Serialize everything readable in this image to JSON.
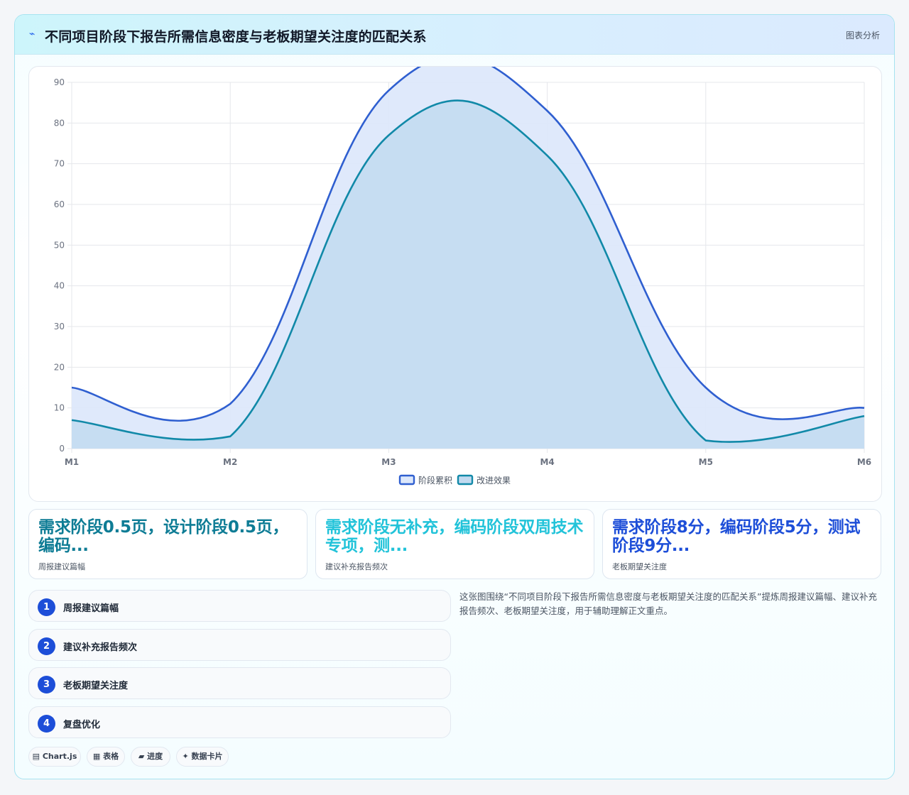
{
  "header": {
    "icon": "chart-line-icon",
    "title": "不同项目阶段下报告所需信息密度与老板期望关注度的匹配关系",
    "action_label": "图表分析"
  },
  "chart_data": {
    "type": "area",
    "categories": [
      "M1",
      "M2",
      "M3",
      "M4",
      "M5",
      "M6"
    ],
    "ylim": [
      0,
      90
    ],
    "y_ticks": [
      "0",
      "10",
      "20",
      "30",
      "40",
      "50",
      "60",
      "70",
      "80",
      "90"
    ],
    "grid": true,
    "legend_position": "bottom",
    "series": [
      {
        "name": "阶段累积",
        "values": [
          15,
          11,
          88,
          83,
          15,
          10
        ],
        "color": "#2f5fd0",
        "fill": "#dde8fb"
      },
      {
        "name": "改进效果",
        "values": [
          7,
          3,
          77,
          72,
          2,
          8
        ],
        "color": "#1189a8",
        "fill": "#c2daf0"
      }
    ]
  },
  "stats": [
    {
      "value": "需求阶段0.5页，设计阶段0.5页，编码...",
      "label": "周报建议篇幅",
      "color": "#0e7c95"
    },
    {
      "value": "需求阶段无补充，编码阶段双周技术专项，测...",
      "label": "建议补充报告频次",
      "color": "#22c3d9"
    },
    {
      "value": "需求阶段8分，编码阶段5分，测试阶段9分...",
      "label": "老板期望关注度",
      "color": "#1d4ed8"
    }
  ],
  "steps": [
    {
      "num": "1",
      "label": "周报建议篇幅"
    },
    {
      "num": "2",
      "label": "建议补充报告频次"
    },
    {
      "num": "3",
      "label": "老板期望关注度"
    },
    {
      "num": "4",
      "label": "复盘优化"
    }
  ],
  "description": "这张图围绕“不同项目阶段下报告所需信息密度与老板期望关注度的匹配关系”提炼周报建议篇幅、建议补充报告频次、老板期望关注度，用于辅助理解正文重点。",
  "tags": [
    {
      "icon": "▤",
      "label": "Chart.js"
    },
    {
      "icon": "▦",
      "label": "表格"
    },
    {
      "icon": "▰",
      "label": "进度"
    },
    {
      "icon": "✦",
      "label": "数据卡片"
    }
  ]
}
